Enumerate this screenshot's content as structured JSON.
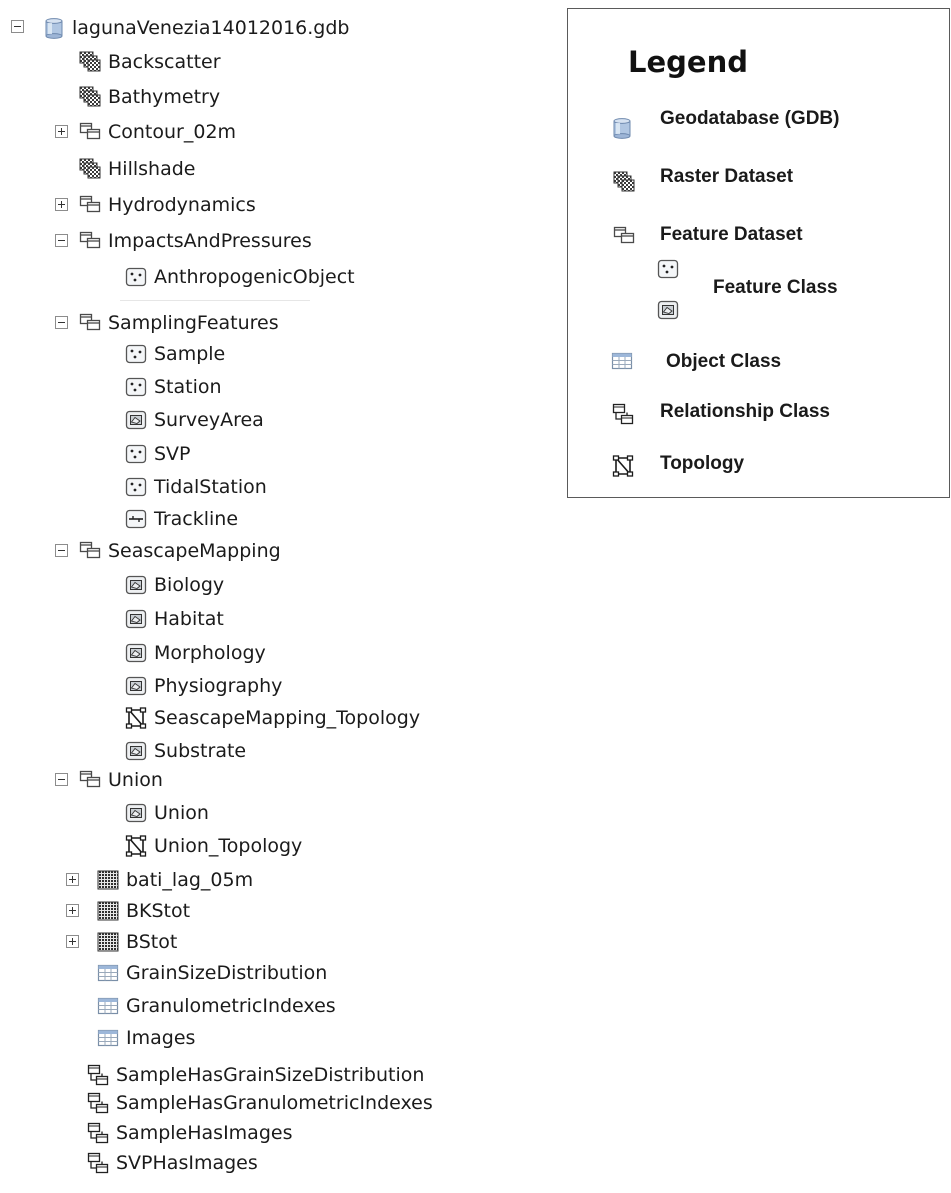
{
  "tree": {
    "root": {
      "label": "lagunaVenezia14012016.gdb",
      "icon": "geodatabase-icon",
      "expanded": true
    },
    "items": [
      {
        "label": "Backscatter",
        "icon": "raster-dataset-icon"
      },
      {
        "label": "Bathymetry",
        "icon": "raster-dataset-icon"
      },
      {
        "label": "Contour_02m",
        "icon": "feature-dataset-icon",
        "expander": "plus"
      },
      {
        "label": "Hillshade",
        "icon": "raster-dataset-icon"
      },
      {
        "label": "Hydrodynamics",
        "icon": "feature-dataset-icon",
        "expander": "plus"
      },
      {
        "label": "ImpactsAndPressures",
        "icon": "feature-dataset-icon",
        "expander": "minus"
      },
      {
        "label": "AnthropogenicObject",
        "icon": "point-feature-class-icon"
      },
      {
        "label": "SamplingFeatures",
        "icon": "feature-dataset-icon",
        "expander": "minus"
      },
      {
        "label": "Sample",
        "icon": "point-feature-class-icon"
      },
      {
        "label": "Station",
        "icon": "point-feature-class-icon"
      },
      {
        "label": "SurveyArea",
        "icon": "polygon-feature-class-icon"
      },
      {
        "label": "SVP",
        "icon": "point-feature-class-icon"
      },
      {
        "label": "TidalStation",
        "icon": "point-feature-class-icon"
      },
      {
        "label": "Trackline",
        "icon": "line-feature-class-icon"
      },
      {
        "label": "SeascapeMapping",
        "icon": "feature-dataset-icon",
        "expander": "minus"
      },
      {
        "label": "Biology",
        "icon": "polygon-feature-class-icon"
      },
      {
        "label": "Habitat",
        "icon": "polygon-feature-class-icon"
      },
      {
        "label": "Morphology",
        "icon": "polygon-feature-class-icon"
      },
      {
        "label": "Physiography",
        "icon": "polygon-feature-class-icon"
      },
      {
        "label": "SeascapeMapping_Topology",
        "icon": "topology-icon"
      },
      {
        "label": "Substrate",
        "icon": "polygon-feature-class-icon"
      },
      {
        "label": "Union",
        "icon": "feature-dataset-icon",
        "expander": "minus"
      },
      {
        "label": "Union",
        "icon": "polygon-feature-class-icon"
      },
      {
        "label": "Union_Topology",
        "icon": "topology-icon"
      },
      {
        "label": "bati_lag_05m",
        "icon": "raster-grid-icon",
        "expander": "plus"
      },
      {
        "label": "BKStot",
        "icon": "raster-grid-icon",
        "expander": "plus"
      },
      {
        "label": "BStot",
        "icon": "raster-grid-icon",
        "expander": "plus"
      },
      {
        "label": "GrainSizeDistribution",
        "icon": "table-icon"
      },
      {
        "label": "GranulometricIndexes",
        "icon": "table-icon"
      },
      {
        "label": "Images",
        "icon": "table-icon"
      },
      {
        "label": "SampleHasGrainSizeDistribution",
        "icon": "relationship-class-icon"
      },
      {
        "label": "SampleHasGranulometricIndexes",
        "icon": "relationship-class-icon"
      },
      {
        "label": "SampleHasImages",
        "icon": "relationship-class-icon"
      },
      {
        "label": "SVPHasImages",
        "icon": "relationship-class-icon"
      }
    ]
  },
  "legend": {
    "title": "Legend",
    "entries": {
      "geodatabase": "Geodatabase (GDB)",
      "raster_dataset": "Raster Dataset",
      "feature_dataset": "Feature Dataset",
      "feature_class": "Feature Class",
      "object_class": "Object Class",
      "relationship_class": "Relationship Class",
      "topology": "Topology"
    }
  },
  "colors": {
    "folder_stroke": "#4a4a4a",
    "table_header": "#9db7d9",
    "gdb_body": "#b0c6e2"
  }
}
